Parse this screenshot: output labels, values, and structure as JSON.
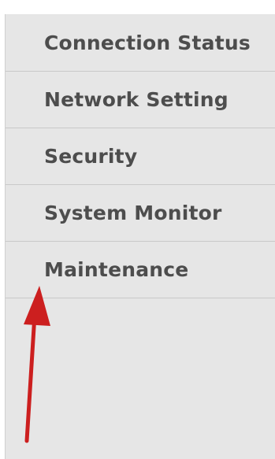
{
  "sidebar": {
    "items": [
      {
        "label": "Connection Status"
      },
      {
        "label": "Network Setting"
      },
      {
        "label": "Security"
      },
      {
        "label": "System Monitor"
      },
      {
        "label": "Maintenance"
      }
    ]
  },
  "annotation": {
    "arrow_color": "#cc1f1f",
    "points_to": "Maintenance"
  },
  "colors": {
    "sidebar_bg": "#e6e6e6",
    "divider": "#c9c9c9",
    "text": "#4d4d4d"
  }
}
